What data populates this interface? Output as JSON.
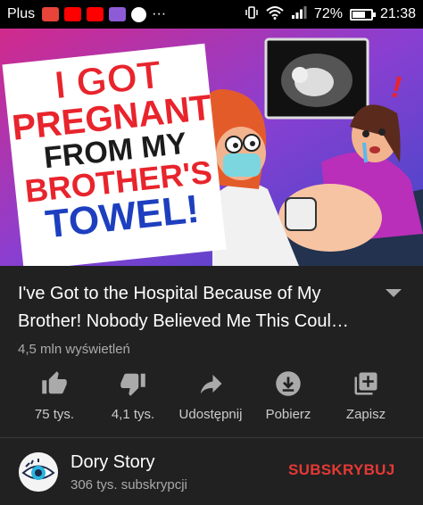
{
  "status_bar": {
    "carrier": "Plus",
    "battery": "72%",
    "battery_level": 0.72,
    "time": "21:38",
    "more": "···"
  },
  "thumbnail": {
    "lines": [
      "I GOT",
      "PREGNANT",
      "FROM MY",
      "BROTHER'S",
      "TOWEL!"
    ],
    "exclamation": "!"
  },
  "video": {
    "title": "I've Got to the Hospital Because of My Brother! Nobody Believed Me This Coul…",
    "views": "4,5 mln wyświetleń"
  },
  "actions": {
    "like": "75 tys.",
    "dislike": "4,1 tys.",
    "share": "Udostępnij",
    "download": "Pobierz",
    "save": "Zapisz"
  },
  "channel": {
    "name": "Dory Story",
    "subscribers": "306 tys. subskrypcji",
    "subscribe_label": "SUBSKRYBUJ"
  },
  "colors": {
    "background": "#212121",
    "subscribe": "#e53935",
    "secondary_text": "#aaaaaa"
  }
}
